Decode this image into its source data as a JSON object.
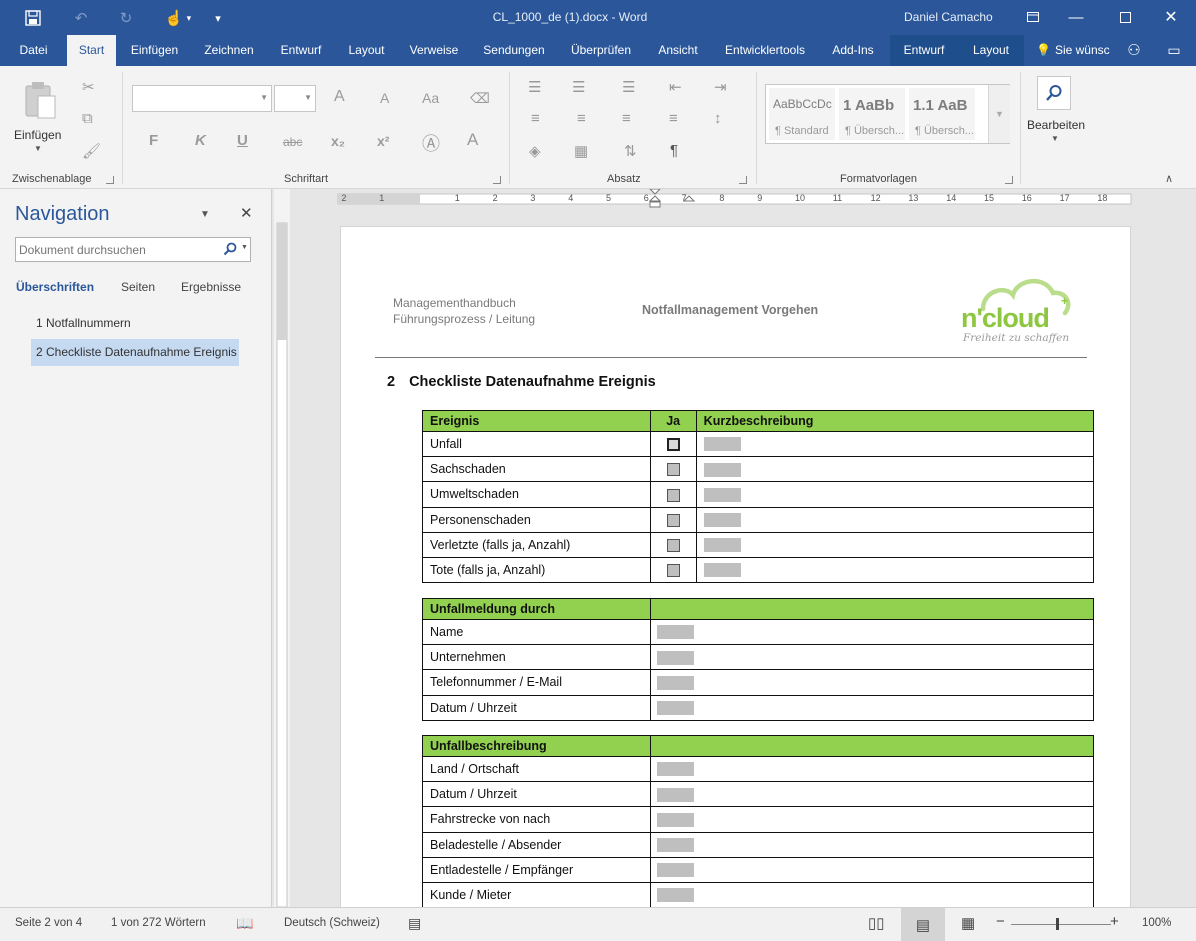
{
  "window": {
    "title": "CL_1000_de (1).docx  -  Word",
    "user": "Daniel Camacho"
  },
  "tabs": [
    {
      "label": "Datei"
    },
    {
      "label": "Start"
    },
    {
      "label": "Einfügen"
    },
    {
      "label": "Zeichnen"
    },
    {
      "label": "Entwurf"
    },
    {
      "label": "Layout"
    },
    {
      "label": "Verweise"
    },
    {
      "label": "Sendungen"
    },
    {
      "label": "Überprüfen"
    },
    {
      "label": "Ansicht"
    },
    {
      "label": "Entwicklertools"
    },
    {
      "label": "Add-Ins"
    },
    {
      "label": "Entwurf"
    },
    {
      "label": "Layout"
    },
    {
      "label": "Sie wünsc"
    }
  ],
  "ribbon": {
    "paste_label": "Einfügen",
    "group_clipboard": "Zwischenablage",
    "group_font": "Schriftart",
    "group_paragraph": "Absatz",
    "group_styles": "Formatvorlagen",
    "edit_label": "Bearbeiten",
    "font_buttons": {
      "bold": "F",
      "italic": "K",
      "underline": "U",
      "strike": "abc",
      "sub": "x₂",
      "sup": "x²",
      "grow": "A",
      "shrink": "A",
      "case": "Aa",
      "color": "A"
    },
    "styles": [
      {
        "preview": "AaBbCcDc",
        "name": "¶ Standard"
      },
      {
        "preview": "1  AaBb",
        "name": "¶ Übersch..."
      },
      {
        "preview": "1.1  AaB",
        "name": "¶ Übersch..."
      }
    ]
  },
  "navigation": {
    "title": "Navigation",
    "search_placeholder": "Dokument durchsuchen",
    "tabs": [
      "Überschriften",
      "Seiten",
      "Ergebnisse"
    ],
    "items": [
      "1 Notfallnummern",
      "2 Checkliste Datenaufnahme Ereignis"
    ]
  },
  "ruler": {
    "h_labels": [
      "2",
      "1",
      "1",
      "2",
      "3",
      "4",
      "5",
      "6",
      "7",
      "8",
      "9",
      "10",
      "11",
      "12",
      "13",
      "14",
      "15",
      "16",
      "17",
      "18"
    ]
  },
  "document": {
    "header_left": [
      "Managementhandbuch",
      "Führungsprozess / Leitung"
    ],
    "header_center": "Notfallmanagement Vorgehen",
    "logo": {
      "word": "n'cloud",
      "tagline": "Freiheit zu schaffen",
      "color": "#8dc63f"
    },
    "heading_number": "2",
    "heading_text": "Checkliste Datenaufnahme Ereignis",
    "table1": {
      "headers": [
        "Ereignis",
        "Ja",
        "Kurzbeschreibung"
      ],
      "rows": [
        "Unfall",
        "Sachschaden",
        "Umweltschaden",
        "Personenschaden",
        "Verletzte (falls ja, Anzahl)",
        "Tote (falls ja, Anzahl)"
      ]
    },
    "table2": {
      "header": "Unfallmeldung durch",
      "rows": [
        "Name",
        "Unternehmen",
        "Telefonnummer / E-Mail",
        "Datum / Uhrzeit"
      ]
    },
    "table3": {
      "header": "Unfallbeschreibung",
      "rows": [
        "Land / Ortschaft",
        "Datum / Uhrzeit",
        "Fahrstrecke von nach",
        "Beladestelle / Absender",
        "Entladestelle / Empfänger",
        "Kunde / Mieter"
      ]
    },
    "header_green": "#92d050"
  },
  "status": {
    "page": "Seite 2 von 4",
    "words": "1 von 272 Wörtern",
    "language": "Deutsch (Schweiz)",
    "zoom": "100%"
  },
  "colors": {
    "brand": "#2b579a",
    "accent_green": "#92d050"
  }
}
